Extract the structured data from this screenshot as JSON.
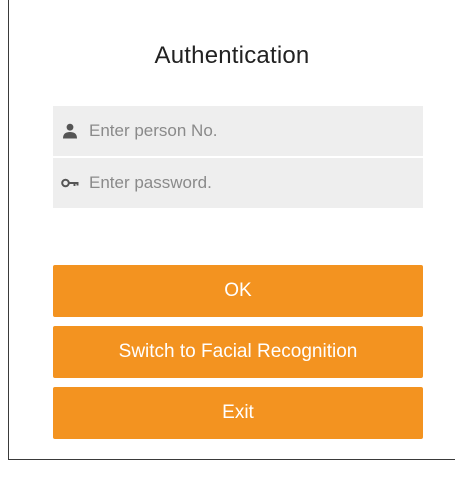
{
  "dialog": {
    "title": "Authentication"
  },
  "fields": {
    "person_no": {
      "placeholder": "Enter person No.",
      "value": "",
      "icon": "person-icon"
    },
    "password": {
      "placeholder": "Enter password.",
      "value": "",
      "icon": "key-icon"
    }
  },
  "buttons": {
    "ok_label": "OK",
    "switch_label": "Switch to Facial Recognition",
    "exit_label": "Exit"
  },
  "colors": {
    "accent": "#f39320",
    "field_bg": "#eeeeee",
    "icon": "#555555"
  }
}
